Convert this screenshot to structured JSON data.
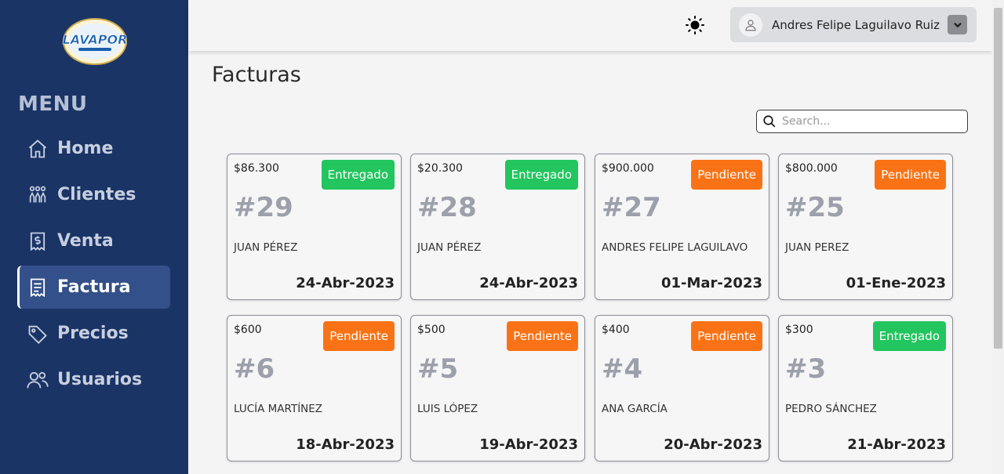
{
  "sidebar": {
    "logo_text": "LAVAPOR",
    "menu_title": "MENU",
    "items": [
      {
        "label": "Home",
        "icon": "home-icon"
      },
      {
        "label": "Clientes",
        "icon": "users-group-icon"
      },
      {
        "label": "Venta",
        "icon": "receipt-dollar-icon"
      },
      {
        "label": "Factura",
        "icon": "invoice-icon",
        "active": true
      },
      {
        "label": "Precios",
        "icon": "tag-icon"
      },
      {
        "label": "Usuarios",
        "icon": "users-icon"
      }
    ]
  },
  "header": {
    "theme_icon": "sun-icon",
    "user_name": "Andres Felipe Laguilavo Ruiz"
  },
  "main": {
    "title": "Facturas",
    "search_placeholder": "Search..."
  },
  "invoices": [
    {
      "price": "$86.300",
      "status": "Entregado",
      "number": "#29",
      "client": "JUAN PÉREZ",
      "date": "24-Abr-2023"
    },
    {
      "price": "$20.300",
      "status": "Entregado",
      "number": "#28",
      "client": "JUAN PÉREZ",
      "date": "24-Abr-2023"
    },
    {
      "price": "$900.000",
      "status": "Pendiente",
      "number": "#27",
      "client": "ANDRES FELIPE LAGUILAVO",
      "date": "01-Mar-2023"
    },
    {
      "price": "$800.000",
      "status": "Pendiente",
      "number": "#25",
      "client": "JUAN PEREZ",
      "date": "01-Ene-2023"
    },
    {
      "price": "$600",
      "status": "Pendiente",
      "number": "#6",
      "client": "LUCÍA MARTÍNEZ",
      "date": "18-Abr-2023"
    },
    {
      "price": "$500",
      "status": "Pendiente",
      "number": "#5",
      "client": "LUIS LÓPEZ",
      "date": "19-Abr-2023"
    },
    {
      "price": "$400",
      "status": "Pendiente",
      "number": "#4",
      "client": "ANA GARCÍA",
      "date": "20-Abr-2023"
    },
    {
      "price": "$300",
      "status": "Entregado",
      "number": "#3",
      "client": "PEDRO SÁNCHEZ",
      "date": "21-Abr-2023"
    }
  ],
  "colors": {
    "sidebar_bg": "#1b3466",
    "active_bg": "#34508a",
    "delivered": "#22c55e",
    "pending": "#f97316"
  }
}
